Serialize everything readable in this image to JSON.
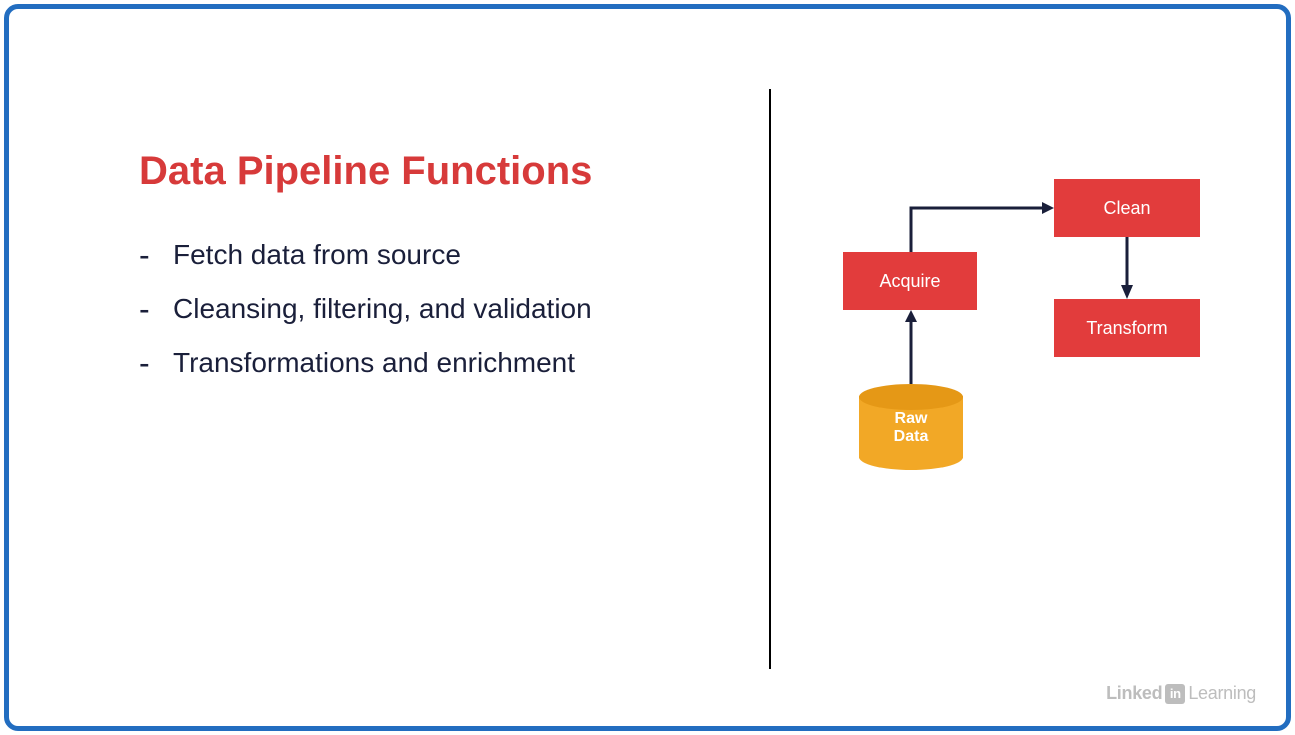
{
  "slide": {
    "title": "Data Pipeline Functions",
    "bullets": [
      "Fetch data from source",
      "Cleansing, filtering, and validation",
      "Transformations and enrichment"
    ]
  },
  "diagram": {
    "raw_data_label_line1": "Raw",
    "raw_data_label_line2": "Data",
    "acquire_label": "Acquire",
    "clean_label": "Clean",
    "transform_label": "Transform"
  },
  "watermark": {
    "brand_part1": "Linked",
    "brand_badge": "in",
    "brand_part2": "Learning"
  },
  "colors": {
    "frame_border": "#226dc0",
    "title_red": "#d73a3a",
    "box_red": "#e23c3c",
    "cylinder_orange": "#f2a826",
    "text_dark": "#1a1f3a"
  }
}
